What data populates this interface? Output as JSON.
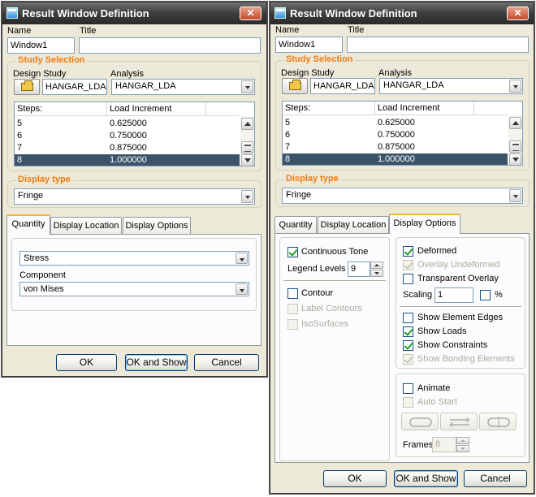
{
  "left": {
    "title": "Result Window Definition",
    "close": "✕",
    "name_label": "Name",
    "title_label": "Title",
    "name_value": "Window1",
    "title_value": "",
    "study_group": "Study Selection",
    "design_study_label": "Design Study",
    "analysis_label": "Analysis",
    "design_study_value": "HANGAR_LDA",
    "analysis_value": "HANGAR_LDA",
    "steps_header": "Steps:",
    "load_header": "Load Increment",
    "rows": [
      {
        "step": "5",
        "load": "0.625000"
      },
      {
        "step": "6",
        "load": "0.750000"
      },
      {
        "step": "7",
        "load": "0.875000"
      },
      {
        "step": "8",
        "load": "1.000000"
      }
    ],
    "display_type_group": "Display type",
    "display_type_value": "Fringe",
    "tabs": [
      "Quantity",
      "Display Location",
      "Display Options"
    ],
    "quantity_value": "Stress",
    "component_label": "Component",
    "component_value": "von Mises",
    "ok": "OK",
    "ok_show": "OK and Show",
    "cancel": "Cancel"
  },
  "right": {
    "title": "Result Window Definition",
    "close": "✕",
    "name_label": "Name",
    "title_label": "Title",
    "name_value": "Window1",
    "title_value": "",
    "study_group": "Study Selection",
    "design_study_label": "Design Study",
    "analysis_label": "Analysis",
    "design_study_value": "HANGAR_LDA",
    "analysis_value": "HANGAR_LDA",
    "steps_header": "Steps:",
    "load_header": "Load Increment",
    "rows": [
      {
        "step": "5",
        "load": "0.625000"
      },
      {
        "step": "6",
        "load": "0.750000"
      },
      {
        "step": "7",
        "load": "0.875000"
      },
      {
        "step": "8",
        "load": "1.000000"
      }
    ],
    "display_type_group": "Display type",
    "display_type_value": "Fringe",
    "tabs": [
      "Quantity",
      "Display Location",
      "Display Options"
    ],
    "opts": {
      "continuous_tone": "Continuous Tone",
      "legend_levels": "Legend Levels",
      "legend_levels_value": "9",
      "contour": "Contour",
      "label_contours": "Label Contours",
      "isosurfaces": "IsoSurfaces",
      "deformed": "Deformed",
      "overlay_undeformed": "Overlay Undeformed",
      "transparent_overlay": "Transparent Overlay",
      "scaling": "Scaling",
      "scaling_value": "1",
      "percent": "%",
      "show_element_edges": "Show Element Edges",
      "show_loads": "Show Loads",
      "show_constraints": "Show Constraints",
      "show_bonding": "Show Bonding Elements",
      "animate": "Animate",
      "auto_start": "Auto Start",
      "frames": "Frames",
      "frames_value": "8"
    },
    "ok": "OK",
    "ok_show": "OK and Show",
    "cancel": "Cancel"
  }
}
